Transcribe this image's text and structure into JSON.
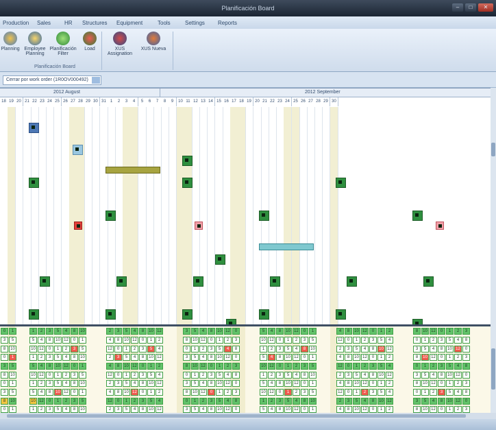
{
  "window": {
    "title": "Planificación Board"
  },
  "menu": [
    "Production",
    "Sales",
    "HR",
    "Structures",
    "Equipment",
    "Tools",
    "Settings",
    "Reports"
  ],
  "ribbon": {
    "buttons": [
      {
        "label": "Planning",
        "icon": "calendar-person-icon"
      },
      {
        "label": "Employee Planning",
        "icon": "employee-clock-icon"
      },
      {
        "label": "Planificación Filter",
        "icon": "filter-icon"
      },
      {
        "label": "Load",
        "icon": "load-icon"
      },
      {
        "label": "XUS Assignation",
        "icon": "assign-user-icon"
      },
      {
        "label": "XUS Nueva",
        "icon": "group-users-icon"
      }
    ],
    "group_label": "Planificación Board"
  },
  "filter": {
    "value": "Cerrar por work order (1R0OV000492)"
  },
  "months": [
    {
      "label": "2012 August"
    },
    {
      "label": "2012 September"
    }
  ],
  "days": [
    "18",
    "19",
    "20",
    "21",
    "22",
    "23",
    "24",
    "25",
    "26",
    "27",
    "28",
    "29",
    "30",
    "31",
    "1",
    "2",
    "3",
    "4",
    "5",
    "6",
    "7",
    "8",
    "9",
    "10",
    "11",
    "12",
    "13",
    "14",
    "15",
    "16",
    "17",
    "18",
    "19",
    "20",
    "21",
    "22",
    "23",
    "24",
    "25",
    "26",
    "27",
    "28",
    "29",
    "30"
  ],
  "lower_values": [
    "0",
    "1",
    "2",
    "3",
    "5",
    "4",
    "8",
    "10",
    "12"
  ]
}
